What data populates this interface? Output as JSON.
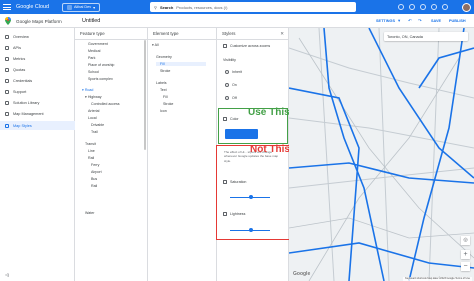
{
  "topbar": {
    "brand": "Google Cloud",
    "project": "Alibal Dev",
    "search_label": "Search",
    "search_placeholder": "Products, resources, docs (/)"
  },
  "subbar": {
    "product": "Google Maps Platform",
    "title": "Untitled",
    "settings": "SETTINGS",
    "save": "SAVE",
    "publish": "PUBLISH"
  },
  "nav": {
    "items": [
      {
        "label": "Overview",
        "icon": "overview-icon"
      },
      {
        "label": "APIs",
        "icon": "api-icon"
      },
      {
        "label": "Metrics",
        "icon": "metrics-icon"
      },
      {
        "label": "Quotas",
        "icon": "quota-icon"
      },
      {
        "label": "Credentials",
        "icon": "key-icon"
      },
      {
        "label": "Support",
        "icon": "support-icon"
      },
      {
        "label": "Solution Library",
        "icon": "library-icon"
      },
      {
        "label": "Map Management",
        "icon": "map-icon"
      },
      {
        "label": "Map Styles",
        "icon": "palette-icon"
      }
    ],
    "active_index": 8
  },
  "feature_type": {
    "header": "Feature type",
    "items": [
      "Government",
      "Medical",
      "Park",
      "Place of worship",
      "School",
      "Sports complex",
      "Road",
      "Highway",
      "Controlled access",
      "Arterial",
      "Local",
      "Drivable",
      "Trail",
      "Transit",
      "Line",
      "Rail",
      "Ferry",
      "Airport",
      "Bus",
      "Rail",
      "Water"
    ]
  },
  "element_type": {
    "header": "Element type",
    "items": [
      "All",
      "Geometry",
      "Fill",
      "Stroke",
      "Labels",
      "Text",
      "Fill",
      "Stroke",
      "Icon"
    ]
  },
  "stylers": {
    "header": "Stylers",
    "customize": "Customize across zooms",
    "visibility": "Visibility",
    "options": [
      "Inherit",
      "On",
      "Off"
    ],
    "color": "Color",
    "note": "The effect of Hi... stylers will change whenever Google updates the base map style.",
    "saturation": "Saturation",
    "lightness": "Lightness",
    "swatch_color": "#1a73e8"
  },
  "annotations": {
    "use_this": "Use This",
    "not_this": "Not This"
  },
  "map": {
    "location": "Toronto, ON, Canada",
    "google": "Google",
    "copyright": "Keyboard shortcuts   Map data ©2023 Google   Terms of Use"
  }
}
